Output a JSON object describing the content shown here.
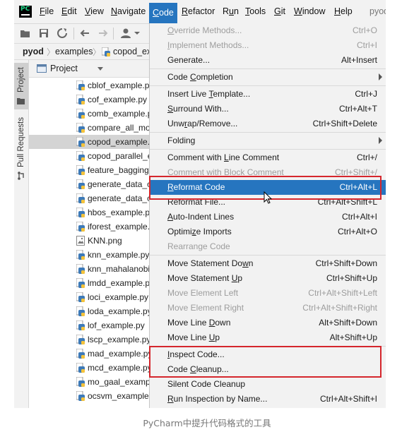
{
  "menubar": {
    "logo": "PC",
    "items": [
      {
        "id": "file",
        "pre": "",
        "u": "F",
        "post": "ile"
      },
      {
        "id": "edit",
        "pre": "",
        "u": "E",
        "post": "dit"
      },
      {
        "id": "view",
        "pre": "",
        "u": "V",
        "post": "iew"
      },
      {
        "id": "navigate",
        "pre": "",
        "u": "N",
        "post": "avigate"
      },
      {
        "id": "code",
        "pre": "",
        "u": "C",
        "post": "ode"
      },
      {
        "id": "refactor",
        "pre": "",
        "u": "R",
        "post": "efactor"
      },
      {
        "id": "run",
        "pre": "R",
        "u": "u",
        "post": "n"
      },
      {
        "id": "tools",
        "pre": "",
        "u": "T",
        "post": "ools"
      },
      {
        "id": "git",
        "pre": "",
        "u": "G",
        "post": "it"
      },
      {
        "id": "window",
        "pre": "",
        "u": "W",
        "post": "indow"
      },
      {
        "id": "help",
        "pre": "",
        "u": "H",
        "post": "elp"
      },
      {
        "id": "project",
        "pre": "pyod",
        "u": "",
        "post": ""
      }
    ]
  },
  "breadcrumb": {
    "items": [
      "pyod",
      "examples",
      "copod_ex"
    ]
  },
  "tool_strip": {
    "project_tab": "Project",
    "pull_requests_tab": "Pull Requests"
  },
  "project_panel": {
    "title": "Project",
    "files": [
      {
        "name": "cblof_example.py",
        "type": "py"
      },
      {
        "name": "cof_example.py",
        "type": "py"
      },
      {
        "name": "comb_example.p",
        "type": "py"
      },
      {
        "name": "compare_all_mo",
        "type": "py"
      },
      {
        "name": "copod_example.",
        "type": "py",
        "selected": true
      },
      {
        "name": "copod_parallel_e",
        "type": "py"
      },
      {
        "name": "feature_bagging",
        "type": "py"
      },
      {
        "name": "generate_data_ca",
        "type": "py"
      },
      {
        "name": "generate_data_cl",
        "type": "py"
      },
      {
        "name": "hbos_example.py",
        "type": "py"
      },
      {
        "name": "iforest_example.",
        "type": "py"
      },
      {
        "name": "KNN.png",
        "type": "png"
      },
      {
        "name": "knn_example.py",
        "type": "py"
      },
      {
        "name": "knn_mahalanobi",
        "type": "py"
      },
      {
        "name": "lmdd_example.p",
        "type": "py"
      },
      {
        "name": "loci_example.py",
        "type": "py"
      },
      {
        "name": "loda_example.py",
        "type": "py"
      },
      {
        "name": "lof_example.py",
        "type": "py"
      },
      {
        "name": "lscp_example.py",
        "type": "py"
      },
      {
        "name": "mad_example.py",
        "type": "py"
      },
      {
        "name": "mcd_example.py",
        "type": "py"
      },
      {
        "name": "mo_gaal_exampl",
        "type": "py"
      },
      {
        "name": "ocsvm_example.",
        "type": "py"
      }
    ]
  },
  "code_menu": {
    "items": [
      {
        "pre": "",
        "u": "O",
        "post": "verride Methods...",
        "shortcut": "Ctrl+O",
        "disabled": true
      },
      {
        "pre": "",
        "u": "I",
        "post": "mplement Methods...",
        "shortcut": "Ctrl+I",
        "disabled": true
      },
      {
        "pre": "Generate...",
        "u": "",
        "post": "",
        "shortcut": "Alt+Insert"
      },
      {
        "sep": true
      },
      {
        "pre": "Code ",
        "u": "C",
        "post": "ompletion",
        "submenu": true
      },
      {
        "sep": true
      },
      {
        "pre": "Insert Live ",
        "u": "T",
        "post": "emplate...",
        "shortcut": "Ctrl+J"
      },
      {
        "pre": "",
        "u": "S",
        "post": "urround With...",
        "shortcut": "Ctrl+Alt+T"
      },
      {
        "pre": "Unw",
        "u": "r",
        "post": "ap/Remove...",
        "shortcut": "Ctrl+Shift+Delete"
      },
      {
        "sep": true
      },
      {
        "pre": "Folding",
        "u": "",
        "post": "",
        "submenu": true
      },
      {
        "sep": true
      },
      {
        "pre": "Comment with ",
        "u": "L",
        "post": "ine Comment",
        "shortcut": "Ctrl+/"
      },
      {
        "pre": "Comment with ",
        "u": "B",
        "post": "lock Comment",
        "shortcut": "Ctrl+Shift+/",
        "disabled": true
      },
      {
        "pre": "",
        "u": "R",
        "post": "eformat Code",
        "shortcut": "Ctrl+Alt+L",
        "highlighted": true
      },
      {
        "pre": "Reformat File...",
        "u": "",
        "post": "",
        "shortcut": "Ctrl+Alt+Shift+L"
      },
      {
        "pre": "",
        "u": "A",
        "post": "uto-Indent Lines",
        "shortcut": "Ctrl+Alt+I"
      },
      {
        "pre": "Optimi",
        "u": "z",
        "post": "e Imports",
        "shortcut": "Ctrl+Alt+O"
      },
      {
        "pre": "Rearrange Code",
        "u": "",
        "post": "",
        "disabled": true
      },
      {
        "sep": true
      },
      {
        "pre": "Move Statement Do",
        "u": "w",
        "post": "n",
        "shortcut": "Ctrl+Shift+Down"
      },
      {
        "pre": "Move Statement ",
        "u": "U",
        "post": "p",
        "shortcut": "Ctrl+Shift+Up"
      },
      {
        "pre": "Move Element Left",
        "u": "",
        "post": "",
        "shortcut": "Ctrl+Alt+Shift+Left",
        "disabled": true
      },
      {
        "pre": "Move Element Right",
        "u": "",
        "post": "",
        "shortcut": "Ctrl+Alt+Shift+Right",
        "disabled": true
      },
      {
        "pre": "Move Line ",
        "u": "D",
        "post": "own",
        "shortcut": "Alt+Shift+Down"
      },
      {
        "pre": "Move Line ",
        "u": "U",
        "post": "p",
        "shortcut": "Alt+Shift+Up"
      },
      {
        "sep": true
      },
      {
        "pre": "",
        "u": "I",
        "post": "nspect Code...",
        "shortcut": ""
      },
      {
        "pre": "Code ",
        "u": "C",
        "post": "leanup...",
        "shortcut": ""
      },
      {
        "pre": "Silent Code Cleanup",
        "u": "",
        "post": "",
        "shortcut": ""
      },
      {
        "pre": "",
        "u": "R",
        "post": "un Inspection by Name...",
        "shortcut": "Ctrl+Alt+Shift+I"
      }
    ]
  },
  "caption": "PyCharm中提升代码格式的工具",
  "colors": {
    "highlight": "#2675bf",
    "annotation_box": "#d5262c",
    "python_icon_blue": "#3d7ab8",
    "python_icon_yellow": "#f5c33b"
  }
}
